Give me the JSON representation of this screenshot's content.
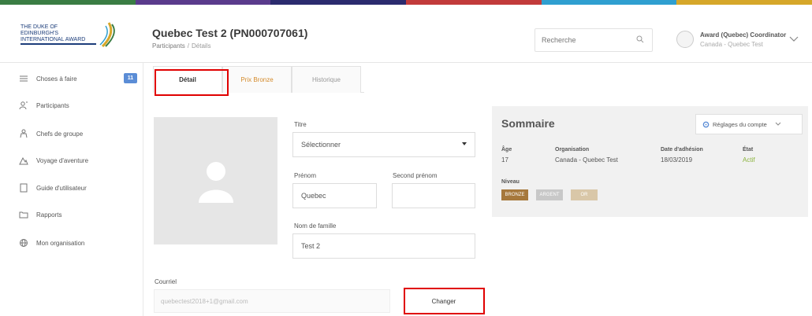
{
  "colors": {
    "topbar": [
      "#3a7d44",
      "#5a3b8c",
      "#2b2b6e",
      "#c23b3b",
      "#2f9fd0",
      "#d6a72a"
    ],
    "level_badges": [
      "#a6783c",
      "#c8c8c8",
      "#d9c7a8"
    ]
  },
  "header": {
    "logo_text": "THE DUKE OF EDINBURGH'S INTERNATIONAL AWARD",
    "title": "Quebec Test 2 (PN000707061)",
    "breadcrumb": [
      "Participants",
      "/",
      "Détails"
    ],
    "search_placeholder": "Recherche",
    "user_name": "Award (Quebec) Coordinator",
    "user_sub": "Canada - Quebec Test"
  },
  "sidebar": {
    "items": [
      {
        "label": "Choses à faire",
        "icon": "list-icon",
        "badge": "11"
      },
      {
        "label": "Participants",
        "icon": "participants-icon"
      },
      {
        "label": "Chefs de groupe",
        "icon": "group-leader-icon"
      },
      {
        "label": "Voyage d'aventure",
        "icon": "mountain-icon"
      },
      {
        "label": "Guide d'utilisateur",
        "icon": "guide-icon"
      },
      {
        "label": "Rapports",
        "icon": "folder-icon"
      },
      {
        "label": "Mon organisation",
        "icon": "globe-icon"
      }
    ]
  },
  "tabs": [
    "Détail",
    "Prix Bronze",
    "Historique"
  ],
  "form": {
    "titre_label": "Titre",
    "titre_value": "Sélectionner",
    "prenom_label": "Prénom",
    "prenom_value": "Quebec",
    "second_prenom_label": "Second prénom",
    "second_prenom_value": "",
    "nom_label": "Nom de famille",
    "nom_value": "Test 2",
    "courriel_label": "Courriel",
    "courriel_value": "quebectest2018+1@gmail.com",
    "change_button": "Changer"
  },
  "summary": {
    "title": "Sommaire",
    "account_button": "Réglages du compte",
    "age_label": "Âge",
    "age_value": "17",
    "org_label": "Organisation",
    "org_value": "Canada - Quebec Test",
    "date_label": "Date d'adhésion",
    "date_value": "18/03/2019",
    "etat_label": "État",
    "etat_value": "Actif",
    "niveau_label": "Niveau",
    "levels": [
      "BRONZE",
      "ARGENT",
      "OR"
    ]
  }
}
